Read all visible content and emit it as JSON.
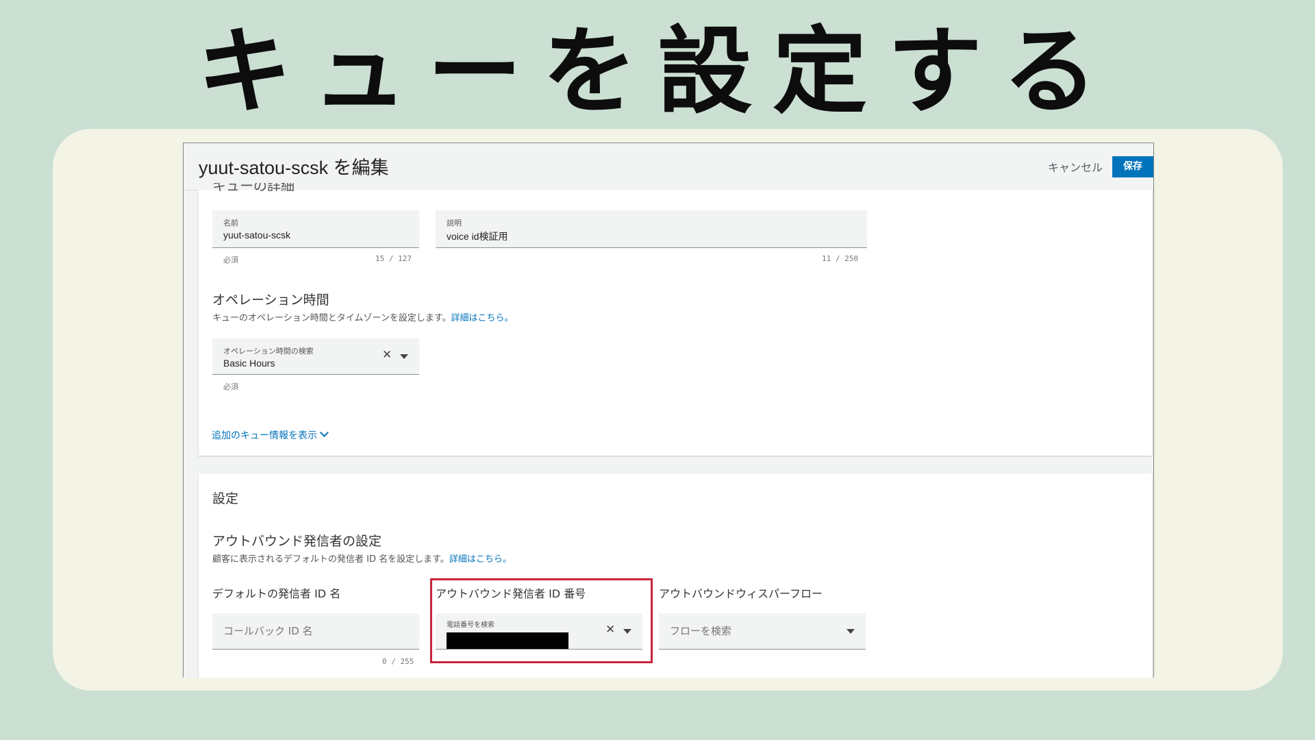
{
  "banner": {
    "title": "キューを設定する"
  },
  "header": {
    "title": "yuut-satou-scsk を編集",
    "cancel_label": "キャンセル",
    "save_label": "保存"
  },
  "details": {
    "cut_heading": "キューの詳細",
    "name": {
      "label": "名前",
      "value": "yuut-satou-scsk",
      "hint": "必須",
      "counter": "15 / 127"
    },
    "description": {
      "label": "説明",
      "value": "voice id検証用",
      "counter": "11 / 250"
    },
    "hours": {
      "heading": "オペレーション時間",
      "desc": "キューのオペレーション時間とタイムゾーンを設定します。",
      "link": "詳細はこちら。",
      "label": "オペレーション時間の検索",
      "value": "Basic Hours",
      "hint": "必須"
    },
    "more_link": "追加のキュー情報を表示"
  },
  "settings": {
    "heading": "設定",
    "outbound": {
      "heading": "アウトバウンド発信者の設定",
      "desc": "顧客に表示されるデフォルトの発信者 ID 名を設定します。",
      "link": "詳細はこちら。",
      "caller_name": {
        "label": "デフォルトの発信者 ID 名",
        "placeholder": "コールバック ID 名",
        "counter": "0 / 255"
      },
      "caller_number": {
        "label": "アウトバウンド発信者 ID 番号",
        "field_label": "電話番号を検索"
      },
      "whisper": {
        "label": "アウトバウンドウィスパーフロー",
        "placeholder": "フローを検索"
      }
    }
  },
  "colors": {
    "background": "#cbdfd3",
    "card": "#f3f4e6",
    "primary": "#0073bb",
    "highlight": "#c8243d"
  }
}
